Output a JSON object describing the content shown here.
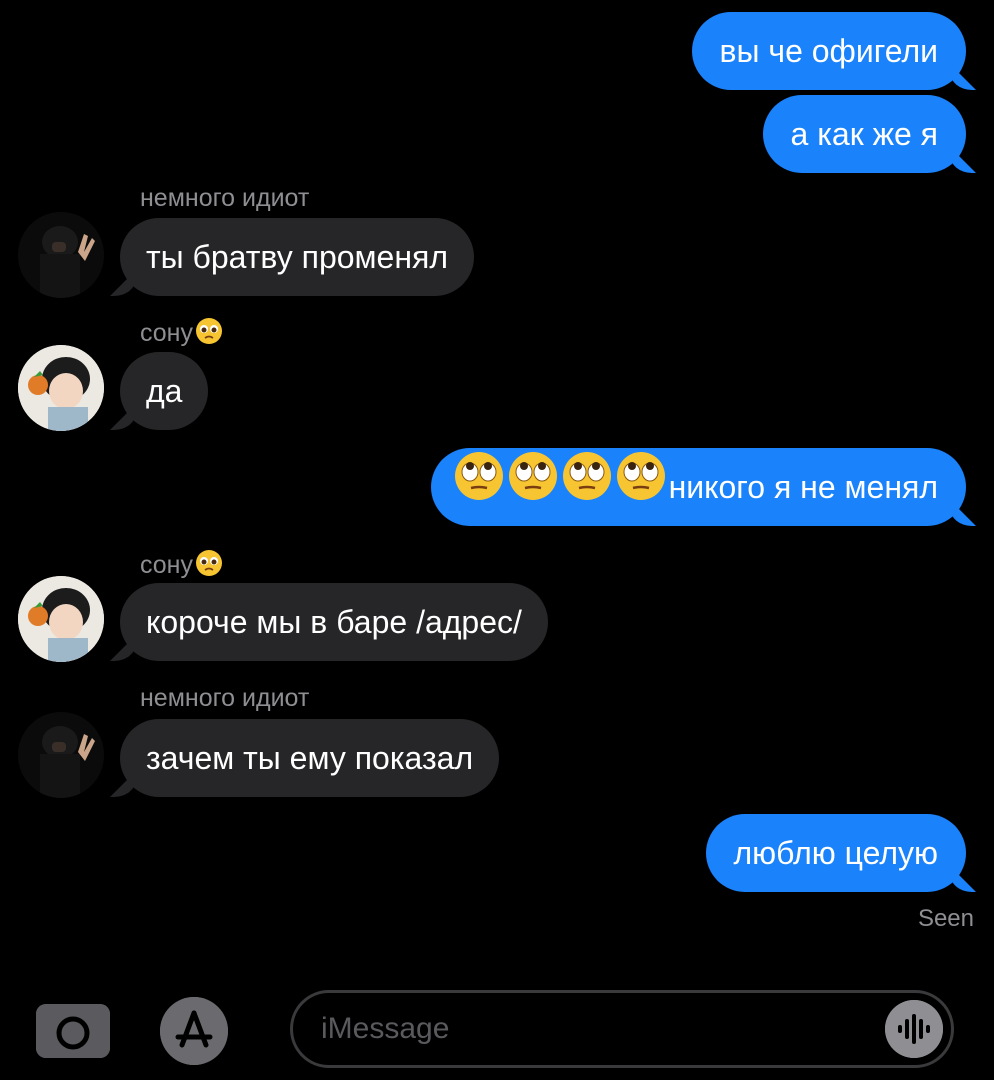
{
  "messages": {
    "m1": "вы че офигели",
    "m2": "а как же я",
    "m3": "ты братву променял",
    "m4": "да",
    "m5_text": "никого я не менял",
    "m6": "короче мы в баре /адрес/",
    "m7": "зачем ты ему показал",
    "m8": "люблю целую"
  },
  "senders": {
    "idiot": "немного идиот",
    "sonu": "сону"
  },
  "status": {
    "seen": "Seen"
  },
  "compose": {
    "placeholder": "iMessage"
  },
  "icons": {
    "camera": "camera-icon",
    "appstore": "app-store-icon",
    "audio": "waveform-icon",
    "pleading": "pleading-face-emoji",
    "eyeroll": "face-with-rolling-eyes-emoji"
  },
  "colors": {
    "outgoing_bubble": "#1a82fb",
    "incoming_bubble": "#262628",
    "background": "#000000",
    "meta_text": "#8e8e93"
  }
}
